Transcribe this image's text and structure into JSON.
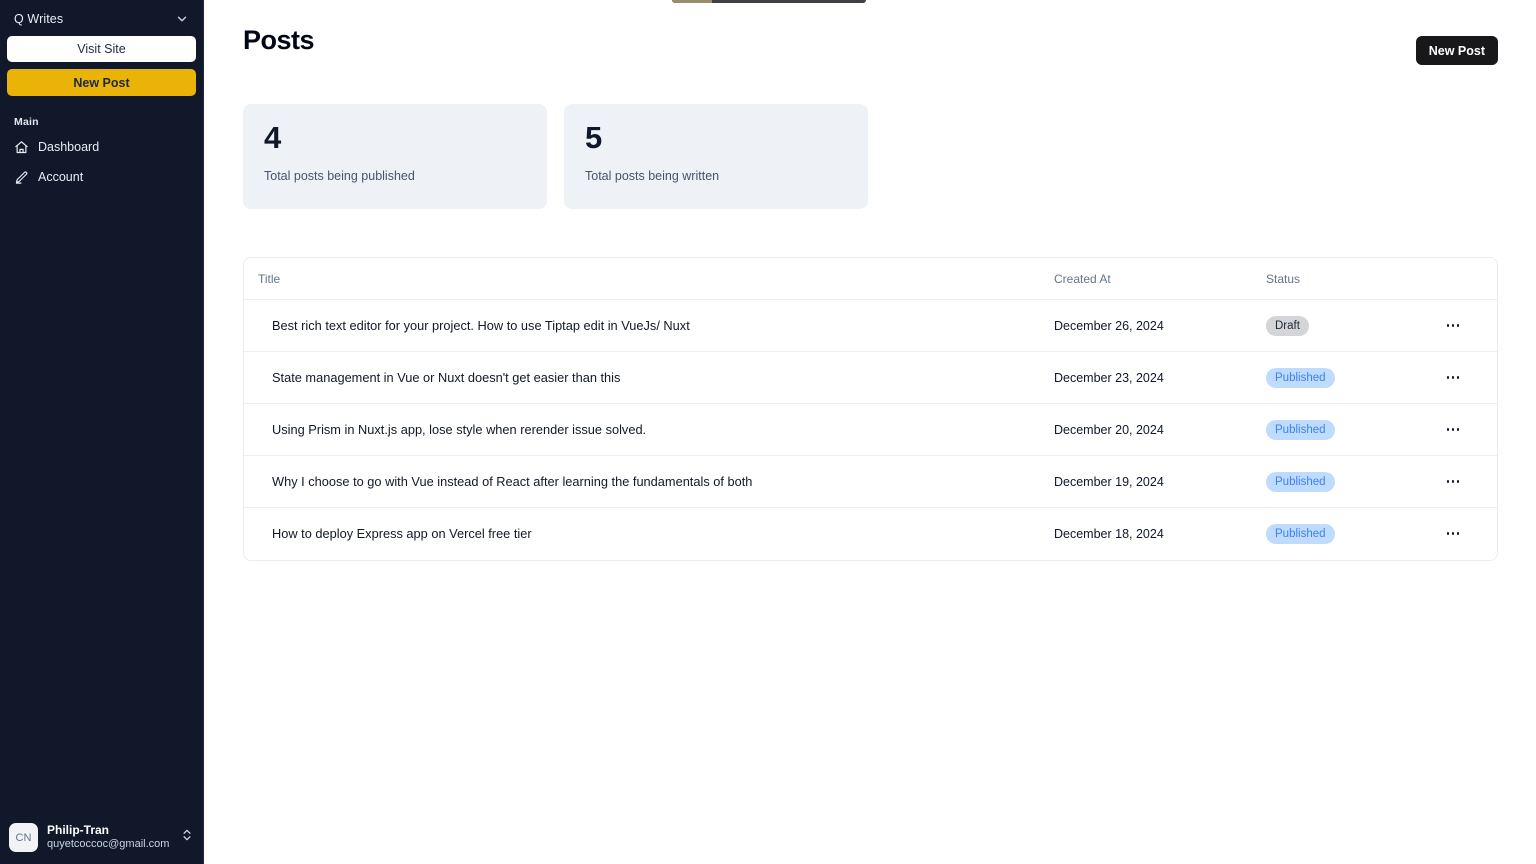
{
  "sidebar": {
    "brand": {
      "name": "Q Writes",
      "chevron_icon": "chevron-down-icon"
    },
    "visit_site_label": "Visit Site",
    "new_post_label": "New Post",
    "section_label": "Main",
    "nav_items": [
      {
        "label": "Dashboard",
        "icon": "home-icon"
      },
      {
        "label": "Account",
        "icon": "pencil-icon"
      }
    ],
    "user": {
      "initials": "CN",
      "name": "Philip-Tran",
      "email": "quyetcoccoc@gmail.com",
      "switcher_icon": "chevrons-up-down-icon"
    }
  },
  "header": {
    "title": "Posts",
    "new_post_label": "New Post"
  },
  "stats": [
    {
      "value": "4",
      "label": "Total posts being published"
    },
    {
      "value": "5",
      "label": "Total posts being written"
    }
  ],
  "table": {
    "columns": [
      "Title",
      "Created At",
      "Status",
      ""
    ],
    "rows": [
      {
        "title": "Best rich text editor for your project. How to use Tiptap edit in VueJs/ Nuxt",
        "created_at": "December 26, 2024",
        "status": "Draft",
        "status_kind": "draft",
        "actions_icon": "ellipsis-icon"
      },
      {
        "title": "State management in Vue or Nuxt doesn't get easier than this",
        "created_at": "December 23, 2024",
        "status": "Published",
        "status_kind": "published",
        "actions_icon": "ellipsis-icon"
      },
      {
        "title": "Using Prism in Nuxt.js app, lose style when rerender issue solved.",
        "created_at": "December 20, 2024",
        "status": "Published",
        "status_kind": "published",
        "actions_icon": "ellipsis-icon"
      },
      {
        "title": "Why I choose to go with Vue instead of React after learning the fundamentals of both",
        "created_at": "December 19, 2024",
        "status": "Published",
        "status_kind": "published",
        "actions_icon": "ellipsis-icon"
      },
      {
        "title": "How to deploy Express app on Vercel free tier",
        "created_at": "December 18, 2024",
        "status": "Published",
        "status_kind": "published",
        "actions_icon": "ellipsis-icon"
      }
    ]
  },
  "colors": {
    "sidebar_bg": "#101829",
    "accent_yellow": "#eab308",
    "button_dark": "#18181b",
    "stat_card_bg": "#eef2f7",
    "badge_draft_bg": "#d3d5d9",
    "badge_published_bg": "#bfdbfe",
    "badge_published_text": "#3b82f6"
  }
}
